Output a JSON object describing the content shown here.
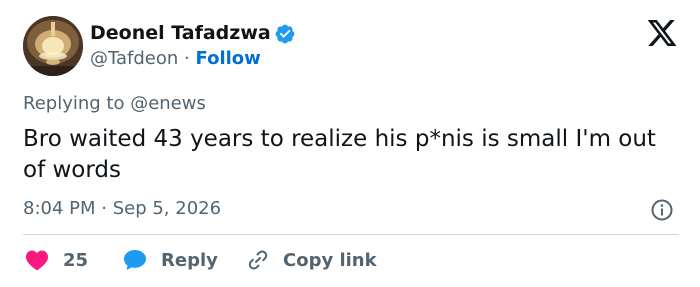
{
  "author": {
    "display_name": "Deonel Tafadzwa",
    "handle": "@Tafdeon",
    "separator": "·",
    "follow_label": "Follow",
    "verified": true
  },
  "reply_context": {
    "text": "Replying to @enews"
  },
  "tweet": {
    "text": "Bro waited 43 years to realize his p*nis is small I'm out of words",
    "timestamp": "8:04 PM · Sep 5, 2026"
  },
  "actions": {
    "like_count": "25",
    "reply_label": "Reply",
    "copy_link_label": "Copy link"
  },
  "icons": {
    "logo": "x-logo-icon",
    "verified": "verified-badge-icon",
    "info": "info-icon",
    "like": "heart-icon",
    "reply": "speech-bubble-icon",
    "copy": "link-icon"
  },
  "colors": {
    "text": "#0f1419",
    "secondary": "#536471",
    "link": "#006fd6",
    "verified": "#1d9bf0",
    "heart": "#f91880",
    "reply_bubble": "#1d9bf0",
    "divider": "#cfd9de"
  }
}
